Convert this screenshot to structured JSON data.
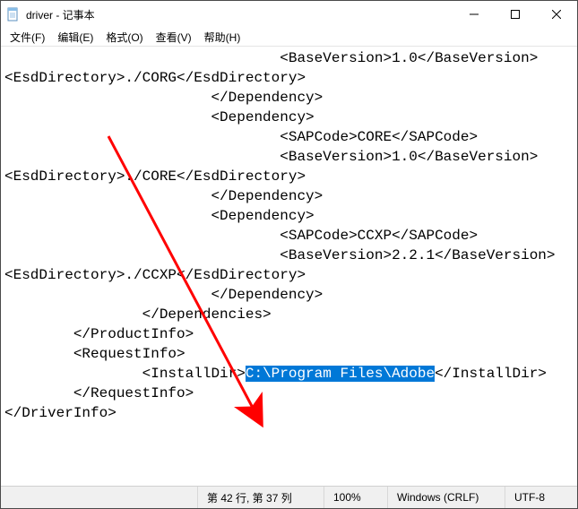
{
  "window": {
    "title": "driver - 记事本"
  },
  "menu": {
    "file": "文件(F)",
    "edit": "编辑(E)",
    "format": "格式(O)",
    "view": "查看(V)",
    "help": "帮助(H)"
  },
  "editor": {
    "l1": "                                <BaseVersion>1.0</BaseVersion>",
    "l2": "",
    "l3": "<EsdDirectory>./CORG</EsdDirectory>",
    "l4": "                        </Dependency>",
    "l5": "                        <Dependency>",
    "l6": "                                <SAPCode>CORE</SAPCode>",
    "l7": "                                <BaseVersion>1.0</BaseVersion>",
    "l8": "",
    "l9": "<EsdDirectory>./CORE</EsdDirectory>",
    "l10": "                        </Dependency>",
    "l11": "                        <Dependency>",
    "l12": "                                <SAPCode>CCXP</SAPCode>",
    "l13": "                                <BaseVersion>2.2.1</BaseVersion>",
    "l14": "",
    "l15": "<EsdDirectory>./CCXP</EsdDirectory>",
    "l16": "                        </Dependency>",
    "l17": "                </Dependencies>",
    "l18": "        </ProductInfo>",
    "l19": "        <RequestInfo>",
    "l20a": "                <InstallDir>",
    "l20sel": "C:\\Program Files\\Adobe",
    "l20b": "</InstallDir>",
    "l21": "        </RequestInfo>",
    "l22": "</DriverInfo>",
    "selection_value": "C:\\Program Files\\Adobe"
  },
  "status": {
    "cursor": "第 42 行, 第 37 列",
    "zoom": "100%",
    "eol": "Windows (CRLF)",
    "encoding": "UTF-8"
  },
  "annotation": {
    "color": "#ff0000"
  }
}
